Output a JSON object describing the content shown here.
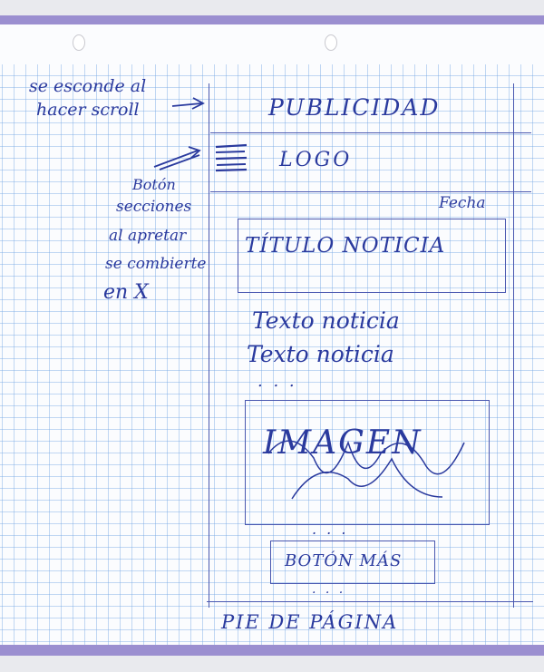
{
  "annotations": {
    "scroll_note_line1": "se esconde al",
    "scroll_note_line2": "hacer scroll",
    "sections_note": [
      "Botón",
      "secciones",
      "al apretar",
      "se combierte",
      "en X"
    ]
  },
  "wireframe": {
    "advertising": "PUBLICIDAD",
    "logo": "LOGO",
    "date": "Fecha",
    "headline": "TÍTULO NOTICIA",
    "body_lines": [
      "Texto noticia",
      "Texto noticia"
    ],
    "ellipsis": ". . .",
    "image_label": "IMAGEN",
    "more_button": "BOTÓN MÁS",
    "footer": "PIE DE PÁGINA"
  },
  "colors": {
    "ink": "#2a3a9e",
    "grid": "#78aae6",
    "margin_band": "#9b8fd0"
  }
}
